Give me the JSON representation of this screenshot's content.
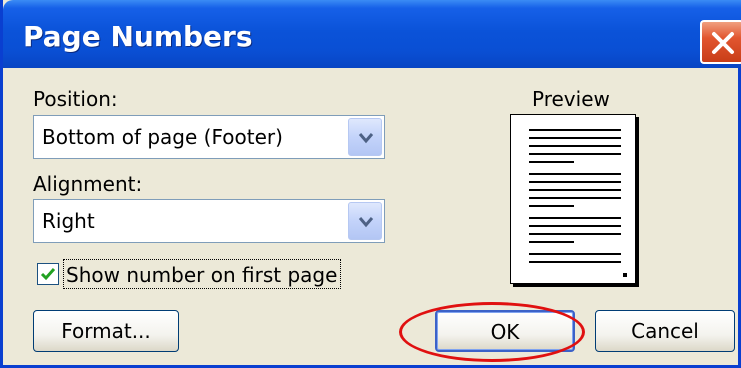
{
  "window": {
    "title": "Page Numbers",
    "close_icon": "close-icon"
  },
  "position": {
    "label": "Position:",
    "value": "Bottom of page (Footer)"
  },
  "alignment": {
    "label": "Alignment:",
    "value": "Right"
  },
  "first_page": {
    "label": "Show number on first page",
    "checked": true
  },
  "preview": {
    "label": "Preview"
  },
  "buttons": {
    "format": "Format...",
    "ok": "OK",
    "cancel": "Cancel"
  },
  "colors": {
    "titlebar": "#0a4fd4",
    "dialog_bg": "#ece9d8",
    "close_button": "#e2562f",
    "highlight_ellipse": "#e01010"
  }
}
